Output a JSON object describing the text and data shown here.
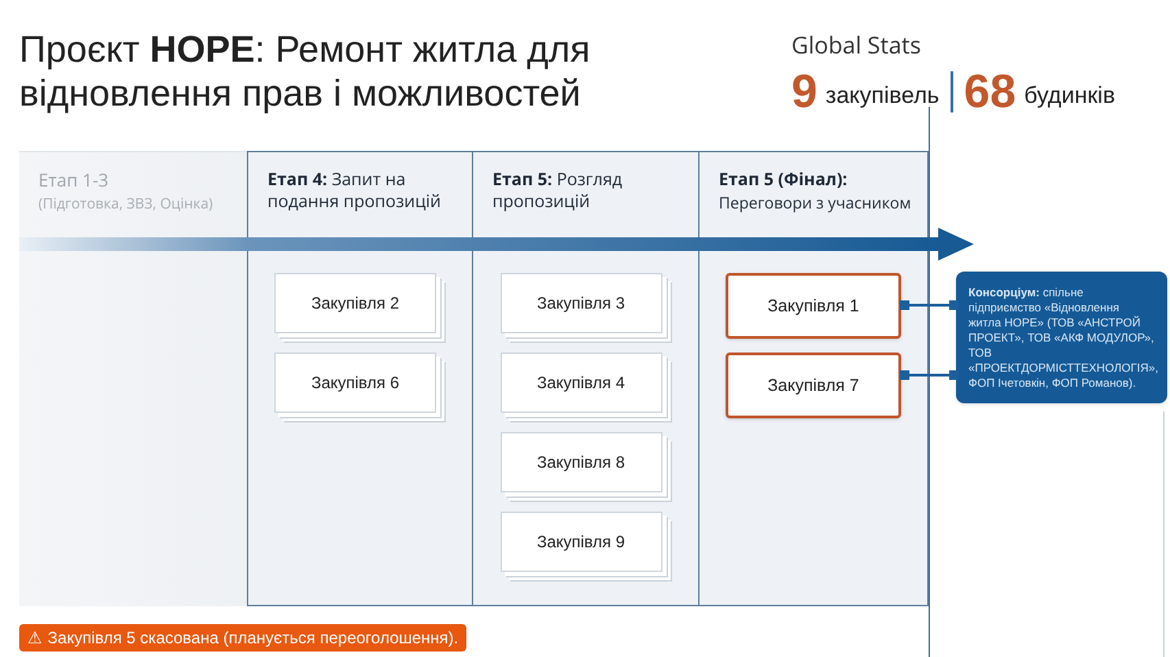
{
  "title": "Проєкт **HOPE**: Ремонт житла для відновлення прав і можливостей",
  "global_stats": {
    "label": "Global Stats",
    "items": [
      {
        "value": "9",
        "unit": "закупівель"
      },
      {
        "value": "68",
        "unit": "будинків"
      }
    ]
  },
  "stages": [
    {
      "kind": "inactive",
      "title": "Етап 1-3",
      "subtitle": "(Підготовка, ЗВЗ, Оцінка)"
    },
    {
      "kind": "active",
      "title": "**Етап 4:** Запит на подання пропозицій",
      "cards": [
        {
          "label": "Закупівля 2",
          "kind": "stacked"
        },
        {
          "label": "Закупівля 6",
          "kind": "stacked"
        }
      ]
    },
    {
      "kind": "active",
      "title": "**Етап 5:** Розгляд пропозицій",
      "cards": [
        {
          "label": "Закупівля 3",
          "kind": "stacked"
        },
        {
          "label": "Закупівля 4",
          "kind": "stacked"
        },
        {
          "label": "Закупівля 8",
          "kind": "stacked"
        },
        {
          "label": "Закупівля 9",
          "kind": "stacked"
        }
      ]
    },
    {
      "kind": "final",
      "title": "Етап 5 (Фінал):",
      "subtitle": "Переговори з учасником",
      "cards": [
        {
          "label": "Закупівля 1",
          "kind": "highlighted"
        },
        {
          "label": "Закупівля 7",
          "kind": "highlighted"
        }
      ]
    }
  ],
  "callout": "**Консорціум:** спільне підприємство «Відновлення житла HOPE» (ТОВ «АНСТРОЙ ПРОЕКТ», ТОВ «АКФ МОДУЛОР», ТОВ «ПРОЕКТДОРМІСТТЕХНОЛОГІЯ», ФОП Ічетовкін, ФОП Романов).",
  "alert": {
    "icon": "⚠",
    "text": "Закупівля 5 скасована (планується переоголошення)."
  }
}
